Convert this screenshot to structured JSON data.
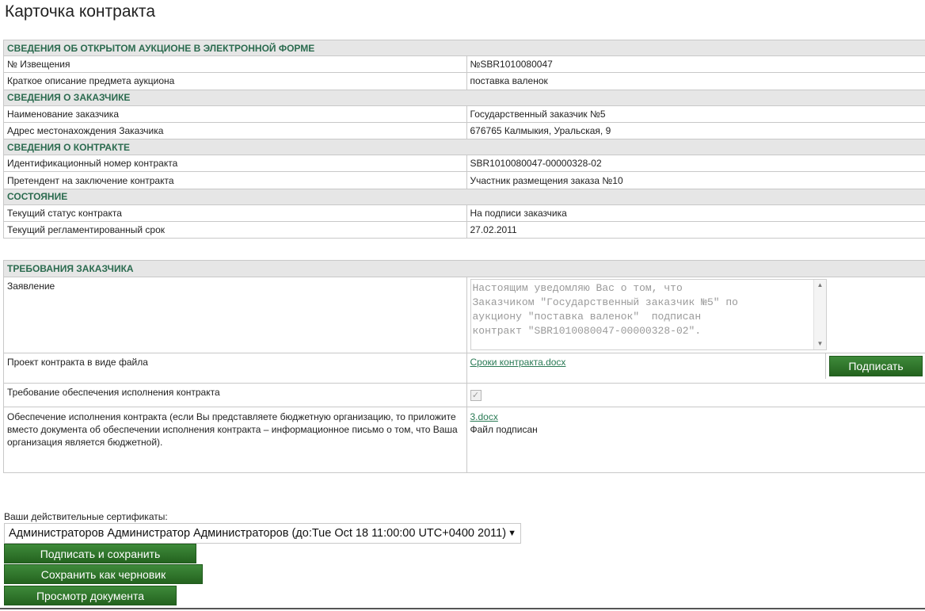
{
  "page_title": "Карточка контракта",
  "auction": {
    "header": "СВЕДЕНИЯ ОБ ОТКРЫТОМ АУКЦИОНЕ В ЭЛЕКТРОННОЙ ФОРМЕ",
    "notice_label": "№ Извещения",
    "notice_value": "№SBR1010080047",
    "subject_label": "Краткое описание предмета аукциона",
    "subject_value": "поставка валенок"
  },
  "customer": {
    "header": "СВЕДЕНИЯ О ЗАКАЗЧИКЕ",
    "name_label": "Наименование заказчика",
    "name_value": "Государственный заказчик №5",
    "address_label": "Адрес местонахождения Заказчика",
    "address_value": "676765 Калмыкия, Уральская, 9"
  },
  "contract": {
    "header": "СВЕДЕНИЯ О КОНТРАКТЕ",
    "id_label": "Идентификационный номер контракта",
    "id_value": "SBR1010080047-00000328-02",
    "applicant_label": "Претендент на заключение контракта",
    "applicant_value": "Участник размещения заказа №10"
  },
  "state": {
    "header": "СОСТОЯНИЕ",
    "status_label": "Текущий статус контракта",
    "status_value": "На подписи заказчика",
    "deadline_label": "Текущий регламентированный срок",
    "deadline_value": "27.02.2011"
  },
  "requirements": {
    "header": "ТРЕБОВАНИЯ ЗАКАЗЧИКА",
    "statement_label": "Заявление",
    "statement_text": "Настоящим уведомляю Вас о том, что\nЗаказчиком \"Государственный заказчик №5\" по\nаукциону \"поставка валенок\"  подписан\nконтракт \"SBR1010080047-00000328-02\".",
    "draft_label": "Проект контракта в виде файла",
    "draft_file": "Сроки контракта.docx",
    "sign_button": "Подписать",
    "security_req_label": "Требование обеспечения исполнения контракта",
    "security_req_checked": true,
    "security_label": "Обеспечение исполнения контракта (если Вы представляете бюджетную организацию, то приложите вместо документа об обеспечении исполнения контракта – информационное письмо о том, что Ваша организация является бюджетной).",
    "security_file": "3.docx",
    "security_status": "Файл подписан"
  },
  "certificates": {
    "label": "Ваши действительные сертификаты:",
    "selected": "Администраторов Администратор Администраторов (до:Tue Oct 18 11:00:00 UTC+0400 2011)"
  },
  "actions": {
    "sign_save": "Подписать и сохранить",
    "save_draft": "Сохранить как черновик",
    "preview": "Просмотр документа"
  },
  "colors": {
    "section_header_text": "#2b6b4f",
    "button_green": "#2f7a2c",
    "link_green": "#2a7a55"
  }
}
